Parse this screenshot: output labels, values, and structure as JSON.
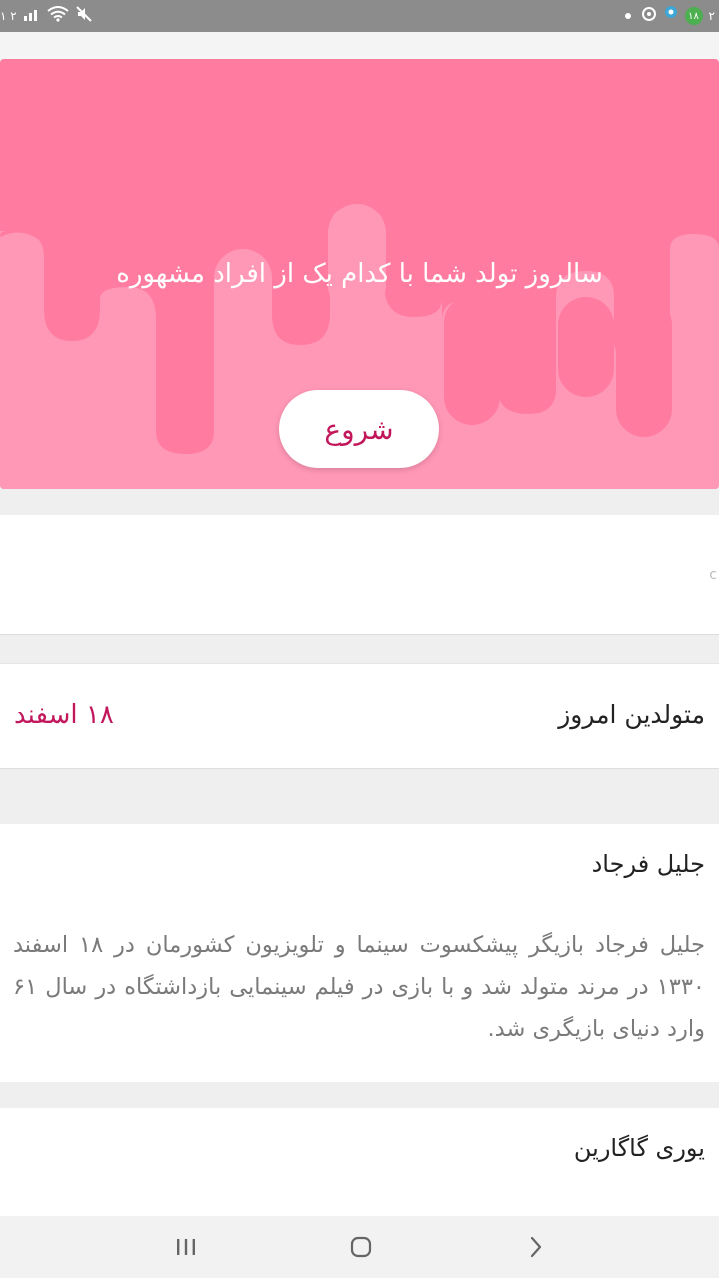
{
  "status_bar": {
    "left_text": "۱ ۲",
    "right_badge": "۱۸",
    "right_time": "۲"
  },
  "hero": {
    "title": "سالروز تولد شما با کدام یک از افراد مشهوره",
    "start_label": "شروع",
    "colors": {
      "background": "#ff7ca0",
      "drips": "#ff97b6",
      "button_text": "#c2185b"
    }
  },
  "today": {
    "title": "متولدین امروز",
    "date": "۱۸  اسفند"
  },
  "people": [
    {
      "name": "جلیل فرجاد",
      "description": "جلیل فرجاد بازیگر پیشکسوت سینما و تلویزیون کشورمان در ۱۸ اسفند ۱۳۳۰ در مرند متولد شد و با بازی در فیلم سینمایی بازداشتگاه در سال ۶۱ وارد دنیای بازیگری شد."
    },
    {
      "name": "یوری گاگارین"
    }
  ],
  "nav": {
    "icons": [
      "recent-apps-icon",
      "home-icon",
      "back-icon"
    ]
  }
}
